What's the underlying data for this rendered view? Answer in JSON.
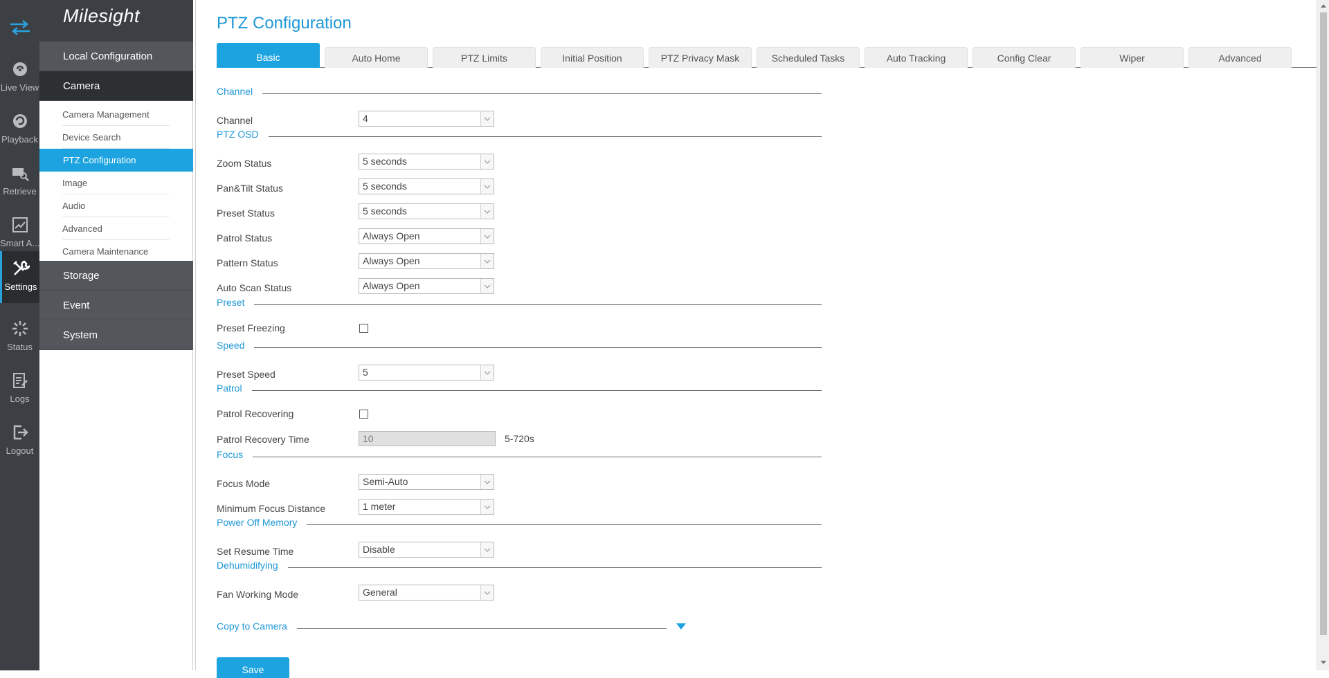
{
  "brand": "Milesight",
  "rail": [
    {
      "label": "Live View",
      "icon": "live-view-icon"
    },
    {
      "label": "Playback",
      "icon": "playback-icon"
    },
    {
      "label": "Retrieve",
      "icon": "retrieve-icon"
    },
    {
      "label": "Smart A...",
      "icon": "smart-analysis-icon"
    },
    {
      "label": "Settings",
      "icon": "settings-icon"
    },
    {
      "label": "Status",
      "icon": "status-icon"
    },
    {
      "label": "Logs",
      "icon": "logs-icon"
    },
    {
      "label": "Logout",
      "icon": "logout-icon"
    }
  ],
  "menu": {
    "local_configuration": "Local Configuration",
    "camera": "Camera",
    "camera_items": [
      "Camera Management",
      "Device Search",
      "PTZ Configuration",
      "Image",
      "Audio",
      "Advanced",
      "Camera Maintenance"
    ],
    "storage": "Storage",
    "event": "Event",
    "system": "System"
  },
  "page_title": "PTZ Configuration",
  "tabs": [
    "Basic",
    "Auto Home",
    "PTZ Limits",
    "Initial Position",
    "PTZ Privacy Mask",
    "Scheduled Tasks",
    "Auto Tracking",
    "Config Clear",
    "Wiper",
    "Advanced"
  ],
  "sections": {
    "channel": "Channel",
    "ptz_osd": "PTZ OSD",
    "preset": "Preset",
    "speed": "Speed",
    "patrol": "Patrol",
    "focus": "Focus",
    "power_off_memory": "Power Off Memory",
    "dehumidifying": "Dehumidifying"
  },
  "fields": {
    "channel": {
      "label": "Channel",
      "value": "4"
    },
    "zoom_status": {
      "label": "Zoom Status",
      "value": "5 seconds"
    },
    "pantilt_status": {
      "label": "Pan&Tilt Status",
      "value": "5 seconds"
    },
    "preset_status": {
      "label": "Preset Status",
      "value": "5 seconds"
    },
    "patrol_status": {
      "label": "Patrol Status",
      "value": "Always Open"
    },
    "pattern_status": {
      "label": "Pattern Status",
      "value": "Always Open"
    },
    "auto_scan_status": {
      "label": "Auto Scan Status",
      "value": "Always Open"
    },
    "preset_freezing": {
      "label": "Preset Freezing",
      "checked": false
    },
    "preset_speed": {
      "label": "Preset Speed",
      "value": "5"
    },
    "patrol_recovering": {
      "label": "Patrol Recovering",
      "checked": false
    },
    "patrol_recovery_time": {
      "label": "Patrol Recovery Time",
      "value": "10",
      "hint": "5-720s"
    },
    "focus_mode": {
      "label": "Focus Mode",
      "value": "Semi-Auto"
    },
    "min_focus_distance": {
      "label": "Minimum Focus Distance",
      "value": "1 meter"
    },
    "set_resume_time": {
      "label": "Set Resume Time",
      "value": "Disable"
    },
    "fan_working_mode": {
      "label": "Fan Working Mode",
      "value": "General"
    }
  },
  "copy_to_camera": "Copy to Camera",
  "save_label": "Save",
  "colors": {
    "accent": "#1da4e0",
    "rail_bg": "#3c4044",
    "menu_bg": "#53575b"
  }
}
